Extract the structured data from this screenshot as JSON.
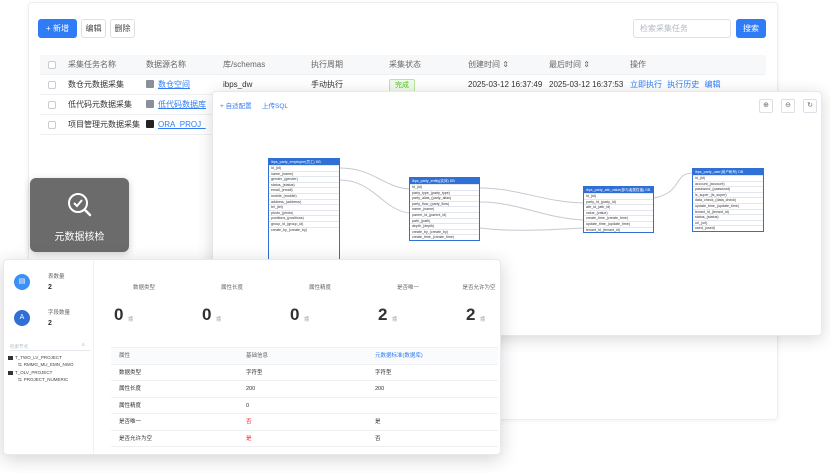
{
  "toolbar": {
    "new_label": "+ 新增",
    "edit_label": "编辑",
    "delete_label": "删除",
    "search_placeholder": "检索采集任务",
    "search_button": "搜索"
  },
  "task_table": {
    "headers": [
      "采集任务名称",
      "数据源名称",
      "库/schemas",
      "执行周期",
      "采集状态",
      "创建时间 ⇕",
      "最后时间 ⇕",
      "操作"
    ],
    "rows": [
      {
        "name": "数仓元数据采集",
        "source": "数仓空间",
        "schema": "ibps_dw",
        "cycle": "手动执行",
        "status": "完成",
        "created": "2025-03-12 16:37:49",
        "last": "2025-03-12 16:37:53",
        "op_run": "立即执行",
        "op_history": "执行历史",
        "op_edit": "编辑"
      },
      {
        "name": "低代码元数据采集",
        "source": "低代码数据库",
        "schema": "",
        "cycle": "",
        "status": "",
        "created": "",
        "last": "",
        "op_run": "",
        "op_history": "",
        "op_edit": ""
      },
      {
        "name": "项目管理元数据采集",
        "source": "ORA_PROJ_",
        "schema": "",
        "cycle": "",
        "status": "",
        "created": "",
        "last": "",
        "op_run": "",
        "op_history": "",
        "op_edit": ""
      }
    ]
  },
  "er_diagram": {
    "toolbar_add": "+ 自适配置",
    "toolbar_upload": "上传SQL",
    "zoom_in": "⊕",
    "zoom_out": "⊖",
    "refresh": "↻",
    "entities": [
      {
        "title": "ibps_party_employee(员工)",
        "badge": "DB",
        "fields": [
          "id_(id)",
          "name_(name)",
          "gender_(gender)",
          "status_(status)",
          "email_(email)",
          "mobile_(mobile)",
          "address_(address)",
          "tel_(tel)",
          "photo_(photo)",
          "positions_(positions)",
          "group_id_(group_id)",
          "create_by_(create_by)"
        ]
      },
      {
        "title": "ibps_party_entity(实体)",
        "badge": "DB",
        "fields": [
          "id_(id)",
          "party_type_(party_type)",
          "party_alias_(party_alias)",
          "party_flow_(party_flow)",
          "name_(name)",
          "parent_id_(parent_id)",
          "path_(path)",
          "depth_(depth)",
          "create_by_(create_by)",
          "create_time_(create_time)"
        ]
      },
      {
        "title": "ibps_party_attr_value(参与者属性值)",
        "badge": "DB",
        "fields": [
          "id_(id)",
          "party_id_(party_id)",
          "attr_id_(attr_id)",
          "value_(value)",
          "create_time_(create_time)",
          "update_time_(update_time)",
          "tenant_id_(tenant_id)"
        ]
      },
      {
        "title": "ibps_party_user(用户帐号)",
        "badge": "DB",
        "fields": [
          "id_(id)",
          "account_(account)",
          "password_(password)",
          "is_super_(is_super)",
          "data_check_(data_check)",
          "update_time_(update_time)",
          "tenant_id_(tenant_id)",
          "status_(status)",
          "url_(url)",
          "used_(used)"
        ]
      }
    ]
  },
  "tool_tile": {
    "label": "元数据核检"
  },
  "check_panel": {
    "summary": [
      {
        "label": "表数量",
        "value": "2",
        "color": "#3b8ff6"
      },
      {
        "label": "字段数量",
        "value": "2",
        "color": "#2f6fd6"
      }
    ],
    "tree_search_placeholder": "检索节点",
    "tree": [
      {
        "label": "T_TWO_LV_PROJECT",
        "level": 0
      },
      {
        "label": "RMMG_MU_EMN_NWO",
        "level": 1
      },
      {
        "label": "T_OLV_PROJECT",
        "level": 0
      },
      {
        "label": "PROJECT_NUMERIC",
        "level": 1
      }
    ],
    "stats": [
      {
        "label": "数据类型",
        "value": "0"
      },
      {
        "label": "属性长度",
        "value": "0"
      },
      {
        "label": "属性精度",
        "value": "0"
      },
      {
        "label": "是否唯一",
        "value": "2"
      },
      {
        "label": "是否允许为空",
        "value": "2"
      }
    ],
    "unit_glyph": "项",
    "detail_headers": [
      "属性",
      "基础信息",
      "元数据标准(数据库)"
    ],
    "detail_rows": [
      {
        "attr": "数据类型",
        "base": "字符型",
        "std": "字符型"
      },
      {
        "attr": "属性长度",
        "base": "200",
        "std": "200"
      },
      {
        "attr": "属性精度",
        "base": "0",
        "std": ""
      },
      {
        "attr": "是否唯一",
        "base": "否",
        "std": "是"
      },
      {
        "attr": "是否允许为空",
        "base": "是",
        "std": "否"
      }
    ]
  },
  "colors": {
    "primary": "#2f7cf6",
    "entity_header": "#2f6fd6",
    "success": "#52c41a",
    "danger": "#f5222d",
    "tile": "#6b6b6b"
  }
}
